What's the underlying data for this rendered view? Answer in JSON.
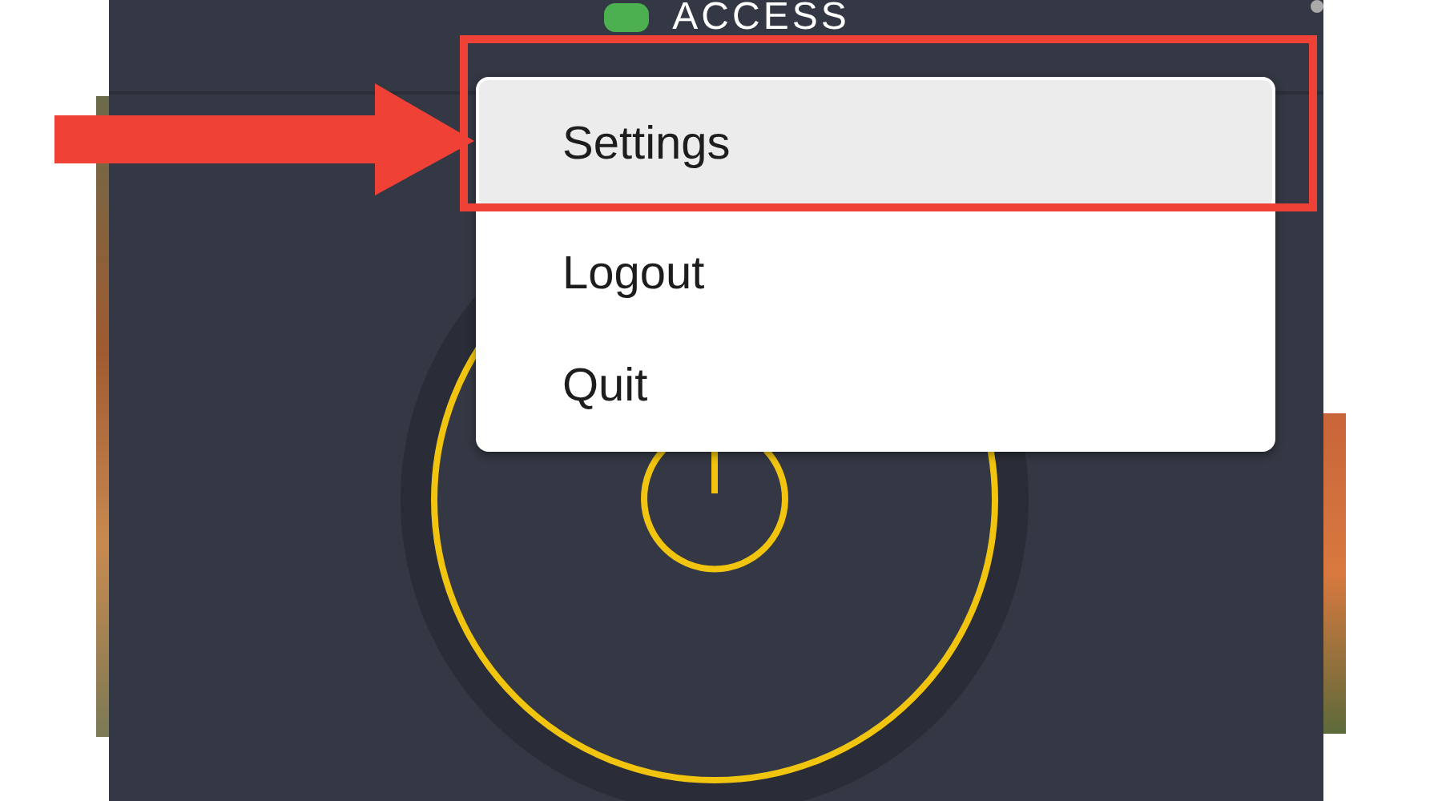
{
  "app": {
    "title": "ACCESS"
  },
  "menu": {
    "items": [
      {
        "label": "Settings",
        "selected": true
      },
      {
        "label": "Logout",
        "selected": false
      },
      {
        "label": "Quit",
        "selected": false
      }
    ]
  }
}
